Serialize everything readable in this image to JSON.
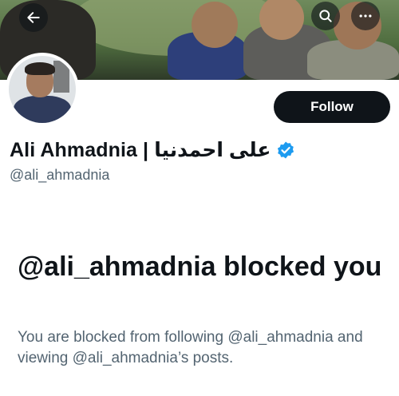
{
  "header": {
    "back_icon": "arrow-left-icon",
    "search_icon": "search-icon",
    "more_icon": "more-horizontal-icon"
  },
  "profile": {
    "display_name": "Ali Ahmadnia | علی احمدنیا",
    "handle": "@ali_ahmadnia",
    "verified": true,
    "verified_color": "#1d9bf0",
    "follow_label": "Follow"
  },
  "blocked": {
    "title": "@ali_ahmadnia blocked you",
    "description": "You are blocked from following @ali_ahmadnia and viewing @ali_ahmadnia’s posts."
  }
}
